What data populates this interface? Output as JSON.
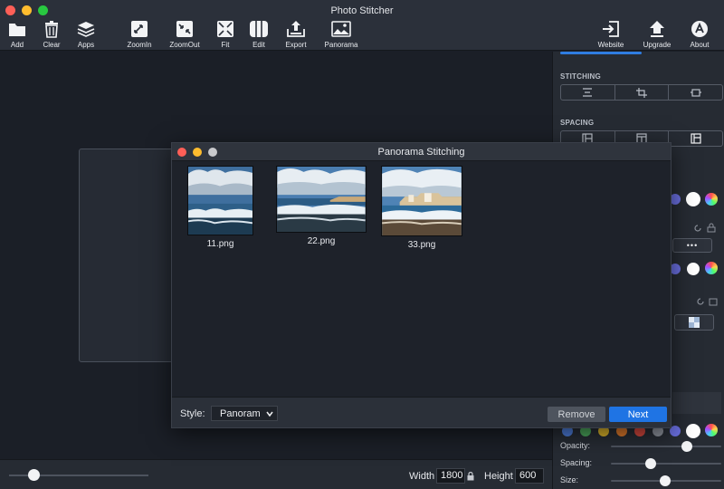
{
  "app": {
    "title": "Photo Stitcher"
  },
  "toolbar": {
    "add": "Add",
    "clear": "Clear",
    "apps": "Apps",
    "zoomin": "ZoomIn",
    "zoomout": "ZoomOut",
    "fit": "Fit",
    "edit": "Edit",
    "export": "Export",
    "panorama": "Panorama",
    "website": "Website",
    "upgrade": "Upgrade",
    "about": "About"
  },
  "panel": {
    "stitching_title": "STITCHING",
    "spacing_title": "SPACING",
    "more_label": "•••",
    "sliders": {
      "opacity": "Opacity:",
      "spacing": "Spacing:",
      "size": "Size:"
    },
    "colors": {
      "accent": "#2f7de1",
      "swatches": [
        "#4c7bd6",
        "#4aa35a",
        "#d6b02b",
        "#d9772b",
        "#d2473d",
        "#8a8f99",
        "#6a6fe0",
        "#ffffff"
      ]
    }
  },
  "bottom": {
    "width_label": "Width",
    "width_value": "1800",
    "height_label": "Height",
    "height_value": "600"
  },
  "modal": {
    "title": "Panorama Stitching",
    "images": [
      {
        "name": "11.png"
      },
      {
        "name": "22.png"
      },
      {
        "name": "33.png"
      }
    ],
    "style_label": "Style:",
    "style_value": "Panoramic",
    "remove_label": "Remove",
    "next_label": "Next"
  }
}
